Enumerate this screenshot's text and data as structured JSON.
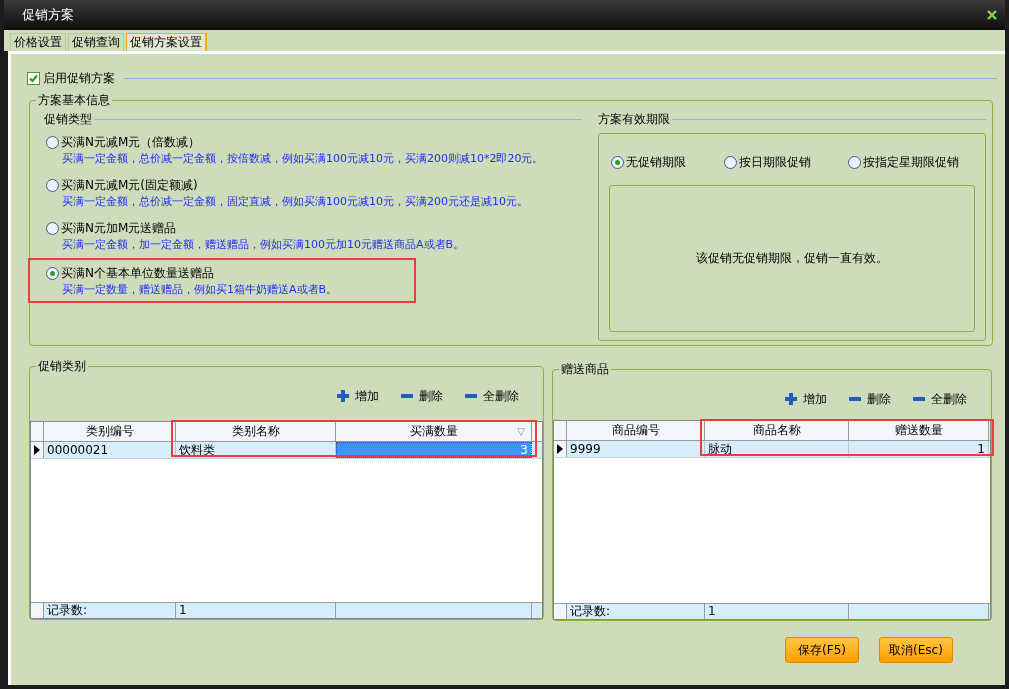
{
  "window": {
    "title": "促销方案"
  },
  "tabs": [
    {
      "label": "价格设置",
      "selected": false
    },
    {
      "label": "促销查询",
      "selected": false
    },
    {
      "label": "促销方案设置",
      "selected": true
    }
  ],
  "enable": {
    "label": "启用促销方案",
    "checked": true
  },
  "basic_info": {
    "title": "方案基本信息",
    "promo_type": {
      "title": "促销类型",
      "options": [
        {
          "label": "买满N元减M元（倍数减）",
          "description": "买满一定金额，总价减一定金额，按倍数减，例如买满100元减10元，买满200则减10*2即20元。",
          "selected": false,
          "highlighted": false
        },
        {
          "label": "买满N元减M元(固定额减)",
          "description": "买满一定金额，总价减一定金额，固定直减，例如买满100元减10元，买满200元还是减10元。",
          "selected": false,
          "highlighted": false
        },
        {
          "label": "买满N元加M元送赠品",
          "description": "买满一定金额，加一定金额，赠送赠品，例如买满100元加10元赠送商品A或者B。",
          "selected": false,
          "highlighted": false
        },
        {
          "label": "买满N个基本单位数量送赠品",
          "description": "买满一定数量，赠送赠品，例如买1箱牛奶赠送A或者B。",
          "selected": true,
          "highlighted": true
        }
      ]
    },
    "validity": {
      "title": "方案有效期限",
      "options": [
        {
          "label": "无促销期限",
          "selected": true
        },
        {
          "label": "按日期限促销",
          "selected": false
        },
        {
          "label": "按指定星期限促销",
          "selected": false
        }
      ],
      "message": "该促销无促销期限，促销一直有效。"
    }
  },
  "panels": [
    {
      "title": "促销类别",
      "actions": [
        {
          "label": "增加",
          "kind": "add"
        },
        {
          "label": "删除",
          "kind": "remove"
        },
        {
          "label": "全删除",
          "kind": "remove"
        }
      ],
      "columns": [
        {
          "label": "类别编号",
          "highlighted": false
        },
        {
          "label": "类别名称",
          "highlighted": true
        },
        {
          "label": "买满数量",
          "highlighted": true,
          "mark": "▽"
        }
      ],
      "rows": [
        {
          "current": true,
          "cells": [
            {
              "text": "00000021",
              "selected": false
            },
            {
              "text": "饮料类",
              "selected": false
            },
            {
              "text": "3",
              "selected": true
            }
          ]
        }
      ],
      "footer": [
        "记录数:",
        "1"
      ]
    },
    {
      "title": "赠送商品",
      "actions": [
        {
          "label": "增加",
          "kind": "add"
        },
        {
          "label": "删除",
          "kind": "remove"
        },
        {
          "label": "全删除",
          "kind": "remove"
        }
      ],
      "columns": [
        {
          "label": "商品编号",
          "highlighted": false
        },
        {
          "label": "商品名称",
          "highlighted": true
        },
        {
          "label": "赠送数量",
          "highlighted": true
        }
      ],
      "rows": [
        {
          "current": true,
          "cells": [
            {
              "text": "9999",
              "selected": false
            },
            {
              "text": "脉动",
              "selected": false
            },
            {
              "text": "1",
              "selected": false
            }
          ]
        }
      ],
      "footer": [
        "记录数:",
        "1"
      ]
    }
  ],
  "buttons": [
    "保存(F5)",
    "取消(Esc)"
  ]
}
